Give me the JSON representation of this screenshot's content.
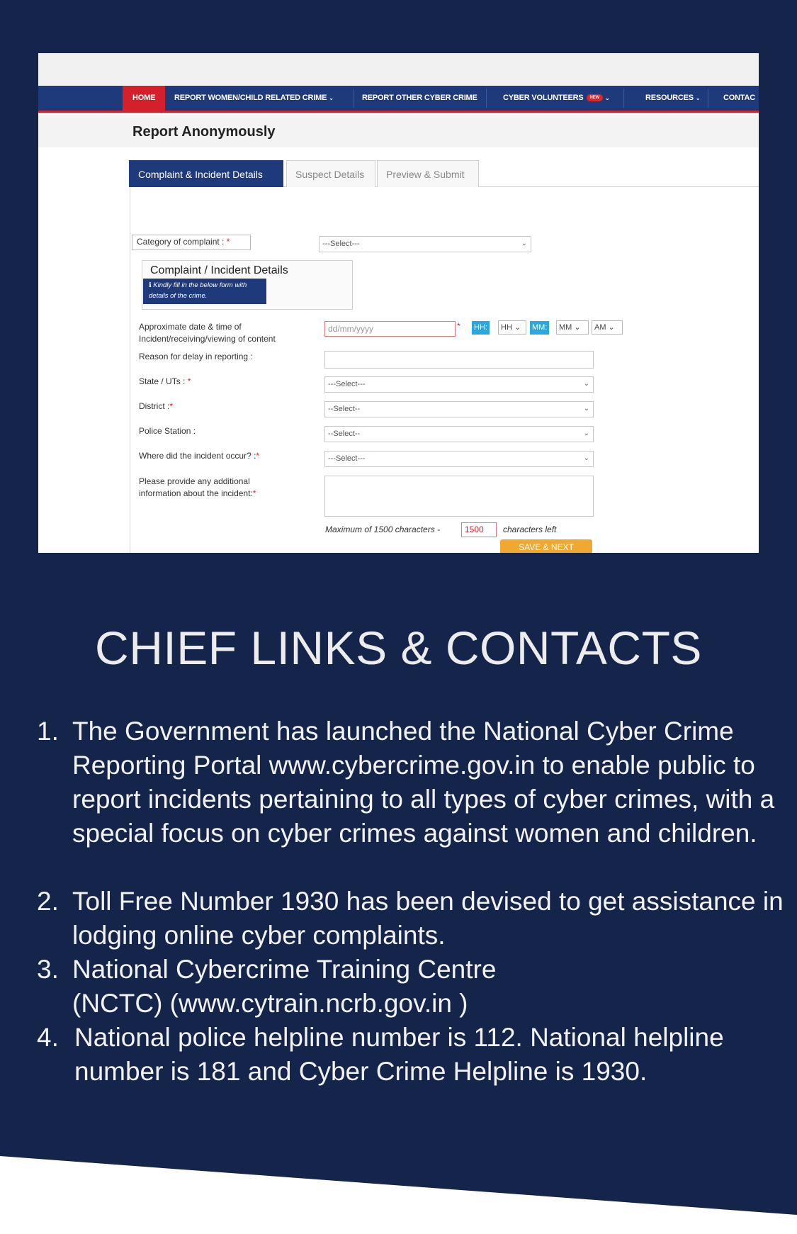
{
  "screenshot": {
    "nav": {
      "home": "HOME",
      "women_child": "REPORT WOMEN/CHILD RELATED CRIME",
      "other": "REPORT OTHER CYBER CRIME",
      "volunteers": "CYBER VOLUNTEERS",
      "new_badge": "NEW",
      "resources": "RESOURCES",
      "contact": "CONTAC"
    },
    "page_title": "Report Anonymously",
    "tabs": [
      "Complaint & Incident Details",
      "Suspect Details",
      "Preview & Submit"
    ],
    "form": {
      "category_label": "Category of complaint :",
      "category_value": "---Select---",
      "panel_title": "Complaint / Incident Details",
      "panel_note": "Kindly fill in the below form with details of the crime.",
      "datetime_label": "Approximate date & time of Incident/receiving/viewing of content",
      "date_placeholder": "dd/mm/yyyy",
      "hh_tag": "HH:",
      "hh_value": "HH",
      "mm_tag": "MM:",
      "mm_value": "MM",
      "ampm_value": "AM",
      "delay_label": "Reason for delay in reporting :",
      "state_label": "State / UTs :",
      "state_value": "---Select---",
      "district_label": "District :",
      "district_value": "--Select--",
      "police_label": "Police Station :",
      "police_value": "--Select--",
      "where_label": "Where did the incident occur? :",
      "where_value": "---Select---",
      "additional_label": "Please provide any additional information about the incident:",
      "max_note": "Maximum of 1500 characters -",
      "count_value": "1500",
      "chars_left": "characters left",
      "save_button": "SAVE & NEXT"
    }
  },
  "heading": "CHIEF LINKS & CONTACTS",
  "items": [
    {
      "num": "1.",
      "text": "The Government has launched the National Cyber Crime Reporting Portal www.cybercrime.gov.in to enable public to report incidents pertaining to all types of cyber crimes, with a special focus on cyber crimes against women and children."
    },
    {
      "num": "2.",
      "text": "Toll Free Number 1930 has been devised to get assistance in lodging online cyber complaints."
    },
    {
      "num": "3.",
      "text": "National Cybercrime Training Centre (NCTC) (www.cytrain.ncrb.gov.in )"
    },
    {
      "num": "4.",
      "text": "National police helpline number is 112. National helpline number is 181 and Cyber Crime Helpline is 1930."
    }
  ],
  "colors": {
    "background": "#14244a",
    "nav": "#1e3a7b",
    "accent_red": "#d4202a",
    "save_button": "#f0a830"
  }
}
